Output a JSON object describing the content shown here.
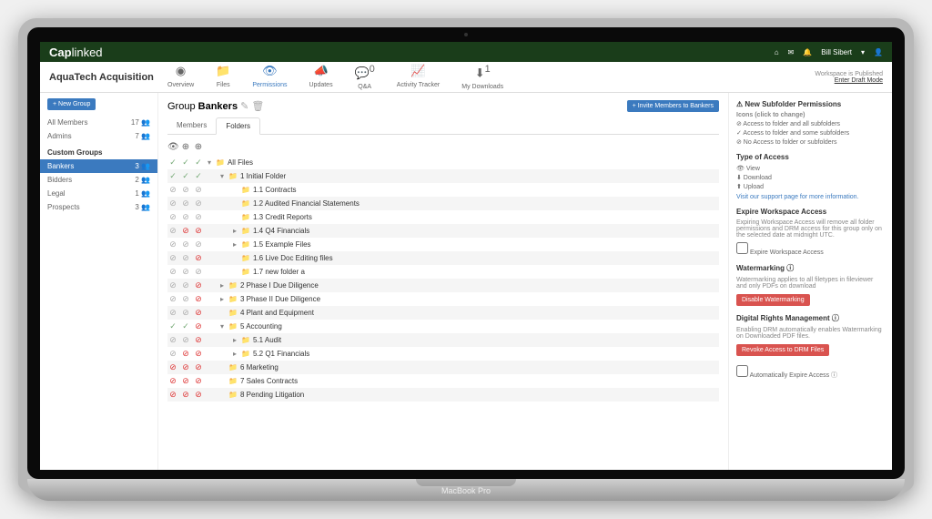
{
  "brand": {
    "cap": "Cap",
    "linked": "linked"
  },
  "user": "Bill Sibert",
  "workspace": "AquaTech Acquisition",
  "nav": {
    "overview": "Overview",
    "files": "Files",
    "permissions": "Permissions",
    "updates": "Updates",
    "qa": "Q&A",
    "qa_badge": "0",
    "activity": "Activity Tracker",
    "downloads": "My Downloads",
    "dl_badge": "1"
  },
  "pub": {
    "status": "Workspace is Published",
    "link": "Enter Draft Mode"
  },
  "sidebar": {
    "newGroup": "+ New Group",
    "allMembers": {
      "label": "All Members",
      "count": "17"
    },
    "admins": {
      "label": "Admins",
      "count": "7"
    },
    "customHead": "Custom Groups",
    "groups": [
      {
        "label": "Bankers",
        "count": "3",
        "active": true
      },
      {
        "label": "Bidders",
        "count": "2",
        "active": false
      },
      {
        "label": "Legal",
        "count": "1",
        "active": false
      },
      {
        "label": "Prospects",
        "count": "3",
        "active": false
      }
    ]
  },
  "group": {
    "prefix": "Group ",
    "name": "Bankers",
    "invite": "+ Invite Members to Bankers"
  },
  "subtabs": {
    "members": "Members",
    "folders": "Folders"
  },
  "tree": [
    {
      "p": [
        "c",
        "c",
        "c"
      ],
      "d": 0,
      "exp": "▾",
      "name": "All Files",
      "alt": false
    },
    {
      "p": [
        "c",
        "c",
        "c"
      ],
      "d": 1,
      "exp": "▾",
      "name": "1 Initial Folder",
      "alt": true
    },
    {
      "p": [
        "g",
        "g",
        "g"
      ],
      "d": 2,
      "exp": "",
      "name": "1.1 Contracts",
      "alt": false
    },
    {
      "p": [
        "g",
        "g",
        "g"
      ],
      "d": 2,
      "exp": "",
      "name": "1.2 Audited Financial Statements",
      "alt": true
    },
    {
      "p": [
        "g",
        "g",
        "g"
      ],
      "d": 2,
      "exp": "",
      "name": "1.3 Credit Reports",
      "alt": false
    },
    {
      "p": [
        "g",
        "x",
        "x"
      ],
      "d": 2,
      "exp": "▸",
      "name": "1.4 Q4 Financials",
      "alt": true
    },
    {
      "p": [
        "g",
        "g",
        "g"
      ],
      "d": 2,
      "exp": "▸",
      "name": "1.5 Example Files",
      "alt": false
    },
    {
      "p": [
        "g",
        "g",
        "x"
      ],
      "d": 2,
      "exp": "",
      "name": "1.6 Live Doc Editing files",
      "alt": true
    },
    {
      "p": [
        "g",
        "g",
        "g"
      ],
      "d": 2,
      "exp": "",
      "name": "1.7 new folder a",
      "alt": false
    },
    {
      "p": [
        "g",
        "g",
        "x"
      ],
      "d": 1,
      "exp": "▸",
      "name": "2 Phase I Due Diligence",
      "alt": true
    },
    {
      "p": [
        "g",
        "g",
        "x"
      ],
      "d": 1,
      "exp": "▸",
      "name": "3 Phase II Due Diligence",
      "alt": false
    },
    {
      "p": [
        "g",
        "g",
        "x"
      ],
      "d": 1,
      "exp": "",
      "name": "4 Plant and Equipment",
      "alt": true
    },
    {
      "p": [
        "c",
        "c",
        "x"
      ],
      "d": 1,
      "exp": "▾",
      "name": "5 Accounting",
      "alt": false
    },
    {
      "p": [
        "g",
        "g",
        "x"
      ],
      "d": 2,
      "exp": "▸",
      "name": "5.1 Audit",
      "alt": true
    },
    {
      "p": [
        "g",
        "x",
        "x"
      ],
      "d": 2,
      "exp": "▸",
      "name": "5.2 Q1 Financials",
      "alt": false
    },
    {
      "p": [
        "x",
        "x",
        "x"
      ],
      "d": 1,
      "exp": "",
      "name": "6 Marketing",
      "alt": true
    },
    {
      "p": [
        "x",
        "x",
        "x"
      ],
      "d": 1,
      "exp": "",
      "name": "7 Sales Contracts",
      "alt": false
    },
    {
      "p": [
        "x",
        "x",
        "x"
      ],
      "d": 1,
      "exp": "",
      "name": "8 Pending Litigation",
      "alt": true
    }
  ],
  "right": {
    "perms": {
      "title": "⚠ New Subfolder Permissions",
      "iconsHint": "Icons (click to change)",
      "l1": "⊘ Access to folder and all subfolders",
      "l2": "✓ Access to folder and some subfolders",
      "l3": "⊘ No Access to folder or subfolders"
    },
    "type": {
      "title": "Type of Access",
      "view": "👁 View",
      "download": "⬇ Download",
      "upload": "⬆ Upload",
      "support": "Visit our support page for more information."
    },
    "expire": {
      "title": "Expire Workspace Access",
      "desc": "Expiring Workspace Access will remove all folder permissions and DRM access for this group only on the selected date at midnight UTC.",
      "chk": "Expire Workspace Access"
    },
    "wm": {
      "title": "Watermarking ⓘ",
      "desc": "Watermarking applies to all filetypes in fileviewer and only PDFs on download",
      "btn": "Disable Watermarking"
    },
    "drm": {
      "title": "Digital Rights Management ⓘ",
      "desc": "Enabling DRM automatically enables Watermarking on Downloaded PDF files.",
      "btn": "Revoke Access to DRM Files"
    },
    "auto": "Automatically Expire Access ⓘ"
  },
  "laptop": "MacBook Pro"
}
